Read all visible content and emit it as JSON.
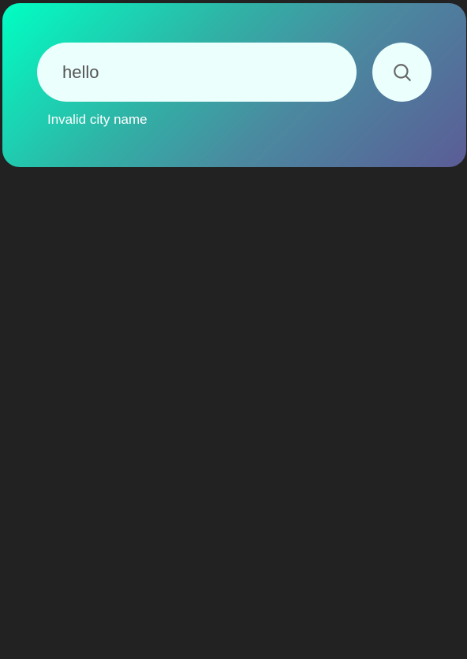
{
  "search": {
    "value": "hello",
    "button_icon": "search-icon",
    "error": "Invalid city name"
  },
  "colors": {
    "background": "#222222",
    "gradient_start": "#00ffc3",
    "gradient_end": "#5b5c96",
    "input_bg": "#ebfffc",
    "error_text": "#ffffff"
  }
}
